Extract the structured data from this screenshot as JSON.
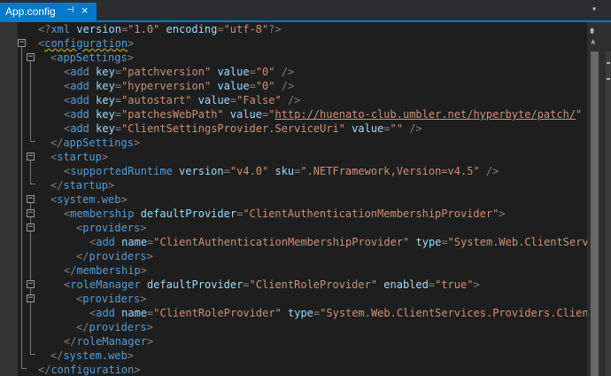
{
  "tab": {
    "title": "App.config",
    "pin_icon": "⊣",
    "close_icon": "×",
    "overflow_icon": "▾"
  },
  "scrollbar": {
    "split_icon": "⇟",
    "up_icon": "▲"
  },
  "code": {
    "l1": {
      "a": "<?",
      "b": "xml",
      "c": " version",
      "d": "=",
      "e": "\"1.0\"",
      "f": " encoding",
      "g": "=",
      "h": "\"utf-8\"",
      "i": "?>"
    },
    "l2": {
      "a": "<",
      "b": "configuration",
      "c": ">"
    },
    "l3": {
      "a": "<",
      "b": "appSettings",
      "c": ">"
    },
    "l4": {
      "a": "<",
      "b": "add",
      "c": " key",
      "d": "=",
      "e": "\"patchversion\"",
      "f": " value",
      "g": "=",
      "h": "\"0\"",
      "i": " />"
    },
    "l5": {
      "a": "<",
      "b": "add",
      "c": " key",
      "d": "=",
      "e": "\"hyperversion\"",
      "f": " value",
      "g": "=",
      "h": "\"0\"",
      "i": " />"
    },
    "l6": {
      "a": "<",
      "b": "add",
      "c": " key",
      "d": "=",
      "e": "\"autostart\"",
      "f": " value",
      "g": "=",
      "h": "\"False\"",
      "i": " />"
    },
    "l7": {
      "a": "<",
      "b": "add",
      "c": " key",
      "d": "=",
      "e": "\"patchesWebPath\"",
      "f": " value",
      "g": "=",
      "h1": "\"",
      "h2": "http://huenato-club.umbler.net/hyperbyte/patch/",
      "h3": "\"",
      "i": " />"
    },
    "l8": {
      "a": "<",
      "b": "add",
      "c": " key",
      "d": "=",
      "e": "\"ClientSettingsProvider.ServiceUri\"",
      "f": " value",
      "g": "=",
      "h": "\"\"",
      "i": " />"
    },
    "l9": {
      "a": "</",
      "b": "appSettings",
      "c": ">"
    },
    "l10": {
      "a": "<",
      "b": "startup",
      "c": ">"
    },
    "l11": {
      "a": "<",
      "b": "supportedRuntime",
      "c": " version",
      "d": "=",
      "e": "\"v4.0\"",
      "f": " sku",
      "g": "=",
      "h": "\".NETFramework,Version=v4.5\"",
      "i": " />"
    },
    "l12": {
      "a": "</",
      "b": "startup",
      "c": ">"
    },
    "l13": {
      "a": "<",
      "b": "system.web",
      "c": ">"
    },
    "l14": {
      "a": "<",
      "b": "membership",
      "c": " defaultProvider",
      "d": "=",
      "e": "\"ClientAuthenticationMembershipProvider\"",
      "f": ">"
    },
    "l15": {
      "a": "<",
      "b": "providers",
      "c": ">"
    },
    "l16": {
      "a": "<",
      "b": "add",
      "c": " name",
      "d": "=",
      "e": "\"ClientAuthenticationMembershipProvider\"",
      "f": " type",
      "g": "=",
      "h": "\"System.Web.ClientServices.Providers.ClientFormsAuthenticationMembershipProvider\""
    },
    "l17": {
      "a": "</",
      "b": "providers",
      "c": ">"
    },
    "l18": {
      "a": "</",
      "b": "membership",
      "c": ">"
    },
    "l19": {
      "a": "<",
      "b": "roleManager",
      "c": " defaultProvider",
      "d": "=",
      "e": "\"ClientRoleProvider\"",
      "f": " enabled",
      "g": "=",
      "h": "\"true\"",
      "i": ">"
    },
    "l20": {
      "a": "<",
      "b": "providers",
      "c": ">"
    },
    "l21": {
      "a": "<",
      "b": "add",
      "c": " name",
      "d": "=",
      "e": "\"ClientRoleProvider\"",
      "f": " type",
      "g": "=",
      "h": "\"System.Web.ClientServices.Providers.ClientRoleProvider\""
    },
    "l22": {
      "a": "</",
      "b": "providers",
      "c": ">"
    },
    "l23": {
      "a": "</",
      "b": "roleManager",
      "c": ">"
    },
    "l24": {
      "a": "</",
      "b": "system.web",
      "c": ">"
    },
    "l25": {
      "a": "</",
      "b": "configuration",
      "c": ">"
    }
  }
}
